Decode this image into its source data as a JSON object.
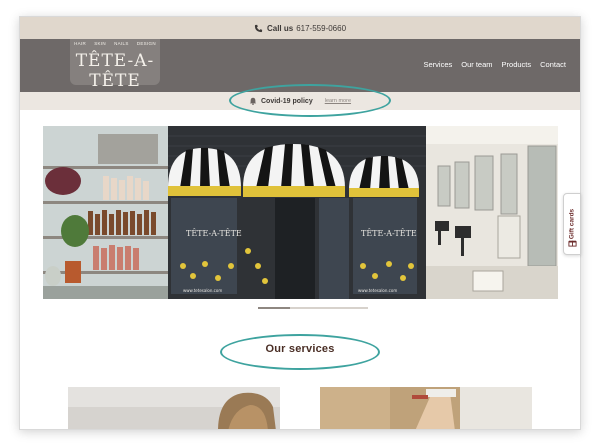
{
  "topbar": {
    "call_label": "Call us",
    "phone": "617-559-0660",
    "icon": "phone-icon"
  },
  "logo": {
    "tags": [
      "HAIR",
      "SKIN",
      "NAILS",
      "DESIGN"
    ],
    "brand": "TÊTE-A-TÊTE"
  },
  "nav": {
    "items": [
      "Services",
      "Our team",
      "Products",
      "Contact"
    ]
  },
  "covid": {
    "icon": "bell-icon",
    "policy_label": "Covid-19 policy",
    "learn_more": "learn more"
  },
  "hero": {
    "storefront_left": "TÊTE-A-TÊTE",
    "storefront_right": "TÊTE-A-TÊTE",
    "storefront_url_left": "www.tetesalon.com",
    "storefront_url_right": "www.tetesalon.com",
    "carousel_active": 1,
    "carousel_total": 3
  },
  "services": {
    "title": "Our services"
  },
  "gift": {
    "label": "Gift cards",
    "icon": "gift-icon"
  },
  "colors": {
    "accent_oval": "#3ea39f",
    "header_bg": "#6e6968",
    "topbar_bg": "#e0d7cc",
    "brand_text": "#4a2e25"
  }
}
